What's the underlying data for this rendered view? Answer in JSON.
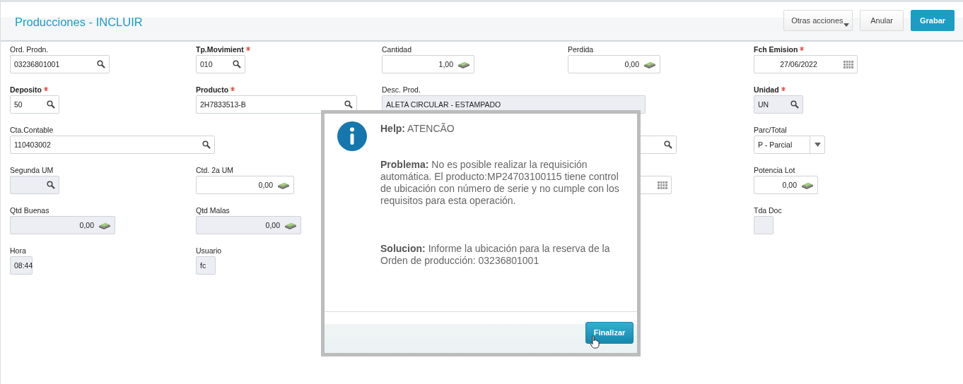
{
  "header": {
    "title": "Producciones - INCLUIR",
    "buttons": [
      {
        "label": "Otras acciones",
        "kind": "menu"
      },
      {
        "label": "Anular",
        "kind": "plain"
      },
      {
        "label": "Grabar",
        "kind": "primary"
      }
    ]
  },
  "fields": [
    {
      "label": "Ord. Prodn.",
      "value": "03236801001",
      "kind": "search",
      "disabled": false,
      "required": false
    },
    {
      "label": "Tp.Movimient",
      "value": "010",
      "kind": "search",
      "disabled": false,
      "required": true
    },
    {
      "label": "Cantidad",
      "value": "1,00",
      "kind": "money",
      "disabled": false,
      "required": false
    },
    {
      "label": "Perdida",
      "value": "0,00",
      "kind": "money",
      "disabled": false,
      "required": false
    },
    {
      "label": "Fch Emision",
      "value": "27/06/2022",
      "kind": "calendar",
      "disabled": false,
      "required": true
    },
    {
      "label": "Deposito",
      "value": "50",
      "kind": "search",
      "disabled": false,
      "required": true
    },
    {
      "label": "Producto",
      "value": "2H7833513-B",
      "kind": "search",
      "disabled": false,
      "required": true
    },
    {
      "label": "Desc. Prod.",
      "value": "ALETA CIRCULAR - ESTAMPADO",
      "kind": "text",
      "disabled": true,
      "required": false
    },
    {
      "label": "Unidad",
      "value": "UN",
      "kind": "search",
      "disabled": true,
      "required": true
    },
    {
      "label": "Cta.Contable",
      "value": "110403002",
      "kind": "search",
      "disabled": false,
      "required": false
    },
    {
      "kind": "search",
      "disabled": false
    },
    {
      "label": "Parc/Total",
      "value": "P - Parcial",
      "kind": "select",
      "disabled": false,
      "required": false
    },
    {
      "label": "Segunda UM",
      "kind": "search",
      "disabled": true,
      "required": false
    },
    {
      "label": "Ctd. 2a UM",
      "value": "0,00",
      "kind": "money",
      "disabled": false,
      "required": false
    },
    {
      "kind": "calendar",
      "disabled": false
    },
    {
      "label": "Potencia Lot",
      "value": "0,00",
      "kind": "money",
      "disabled": false,
      "required": false
    },
    {
      "label": "Qtd Buenas",
      "value": "0,00",
      "kind": "money",
      "disabled": true,
      "required": false
    },
    {
      "label": "Qtd Malas",
      "value": "0,00",
      "kind": "money",
      "disabled": true,
      "required": false
    },
    {
      "label": "Tda Doc",
      "kind": "text",
      "disabled": true,
      "required": false
    },
    {
      "label": "Hora",
      "value": "08:44",
      "kind": "text",
      "disabled": true,
      "required": false
    },
    {
      "label": "Usuario",
      "value": "fc",
      "kind": "text",
      "disabled": true,
      "required": false
    }
  ],
  "dialog": {
    "title": "**Help:** ATENCÃO",
    "problem": "**Problema:** No es posible realizar la requisición automática. El producto:MP24703100115 tiene control de ubicación con número de serie y no cumple con los requisitos para esta operación.",
    "solution": "**Solucion:** Informe la ubicación para la reserva de la Orden de producción: 03236801001",
    "button": "Finalizar"
  }
}
